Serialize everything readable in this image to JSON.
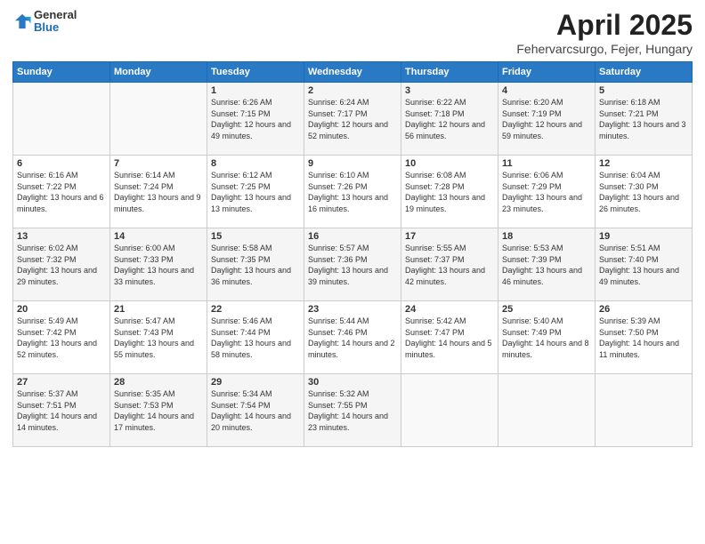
{
  "header": {
    "logo_general": "General",
    "logo_blue": "Blue",
    "title": "April 2025",
    "location": "Fehervarcsurgo, Fejer, Hungary"
  },
  "weekdays": [
    "Sunday",
    "Monday",
    "Tuesday",
    "Wednesday",
    "Thursday",
    "Friday",
    "Saturday"
  ],
  "weeks": [
    [
      {
        "day": "",
        "info": ""
      },
      {
        "day": "",
        "info": ""
      },
      {
        "day": "1",
        "info": "Sunrise: 6:26 AM\nSunset: 7:15 PM\nDaylight: 12 hours and 49 minutes."
      },
      {
        "day": "2",
        "info": "Sunrise: 6:24 AM\nSunset: 7:17 PM\nDaylight: 12 hours and 52 minutes."
      },
      {
        "day": "3",
        "info": "Sunrise: 6:22 AM\nSunset: 7:18 PM\nDaylight: 12 hours and 56 minutes."
      },
      {
        "day": "4",
        "info": "Sunrise: 6:20 AM\nSunset: 7:19 PM\nDaylight: 12 hours and 59 minutes."
      },
      {
        "day": "5",
        "info": "Sunrise: 6:18 AM\nSunset: 7:21 PM\nDaylight: 13 hours and 3 minutes."
      }
    ],
    [
      {
        "day": "6",
        "info": "Sunrise: 6:16 AM\nSunset: 7:22 PM\nDaylight: 13 hours and 6 minutes."
      },
      {
        "day": "7",
        "info": "Sunrise: 6:14 AM\nSunset: 7:24 PM\nDaylight: 13 hours and 9 minutes."
      },
      {
        "day": "8",
        "info": "Sunrise: 6:12 AM\nSunset: 7:25 PM\nDaylight: 13 hours and 13 minutes."
      },
      {
        "day": "9",
        "info": "Sunrise: 6:10 AM\nSunset: 7:26 PM\nDaylight: 13 hours and 16 minutes."
      },
      {
        "day": "10",
        "info": "Sunrise: 6:08 AM\nSunset: 7:28 PM\nDaylight: 13 hours and 19 minutes."
      },
      {
        "day": "11",
        "info": "Sunrise: 6:06 AM\nSunset: 7:29 PM\nDaylight: 13 hours and 23 minutes."
      },
      {
        "day": "12",
        "info": "Sunrise: 6:04 AM\nSunset: 7:30 PM\nDaylight: 13 hours and 26 minutes."
      }
    ],
    [
      {
        "day": "13",
        "info": "Sunrise: 6:02 AM\nSunset: 7:32 PM\nDaylight: 13 hours and 29 minutes."
      },
      {
        "day": "14",
        "info": "Sunrise: 6:00 AM\nSunset: 7:33 PM\nDaylight: 13 hours and 33 minutes."
      },
      {
        "day": "15",
        "info": "Sunrise: 5:58 AM\nSunset: 7:35 PM\nDaylight: 13 hours and 36 minutes."
      },
      {
        "day": "16",
        "info": "Sunrise: 5:57 AM\nSunset: 7:36 PM\nDaylight: 13 hours and 39 minutes."
      },
      {
        "day": "17",
        "info": "Sunrise: 5:55 AM\nSunset: 7:37 PM\nDaylight: 13 hours and 42 minutes."
      },
      {
        "day": "18",
        "info": "Sunrise: 5:53 AM\nSunset: 7:39 PM\nDaylight: 13 hours and 46 minutes."
      },
      {
        "day": "19",
        "info": "Sunrise: 5:51 AM\nSunset: 7:40 PM\nDaylight: 13 hours and 49 minutes."
      }
    ],
    [
      {
        "day": "20",
        "info": "Sunrise: 5:49 AM\nSunset: 7:42 PM\nDaylight: 13 hours and 52 minutes."
      },
      {
        "day": "21",
        "info": "Sunrise: 5:47 AM\nSunset: 7:43 PM\nDaylight: 13 hours and 55 minutes."
      },
      {
        "day": "22",
        "info": "Sunrise: 5:46 AM\nSunset: 7:44 PM\nDaylight: 13 hours and 58 minutes."
      },
      {
        "day": "23",
        "info": "Sunrise: 5:44 AM\nSunset: 7:46 PM\nDaylight: 14 hours and 2 minutes."
      },
      {
        "day": "24",
        "info": "Sunrise: 5:42 AM\nSunset: 7:47 PM\nDaylight: 14 hours and 5 minutes."
      },
      {
        "day": "25",
        "info": "Sunrise: 5:40 AM\nSunset: 7:49 PM\nDaylight: 14 hours and 8 minutes."
      },
      {
        "day": "26",
        "info": "Sunrise: 5:39 AM\nSunset: 7:50 PM\nDaylight: 14 hours and 11 minutes."
      }
    ],
    [
      {
        "day": "27",
        "info": "Sunrise: 5:37 AM\nSunset: 7:51 PM\nDaylight: 14 hours and 14 minutes."
      },
      {
        "day": "28",
        "info": "Sunrise: 5:35 AM\nSunset: 7:53 PM\nDaylight: 14 hours and 17 minutes."
      },
      {
        "day": "29",
        "info": "Sunrise: 5:34 AM\nSunset: 7:54 PM\nDaylight: 14 hours and 20 minutes."
      },
      {
        "day": "30",
        "info": "Sunrise: 5:32 AM\nSunset: 7:55 PM\nDaylight: 14 hours and 23 minutes."
      },
      {
        "day": "",
        "info": ""
      },
      {
        "day": "",
        "info": ""
      },
      {
        "day": "",
        "info": ""
      }
    ]
  ]
}
